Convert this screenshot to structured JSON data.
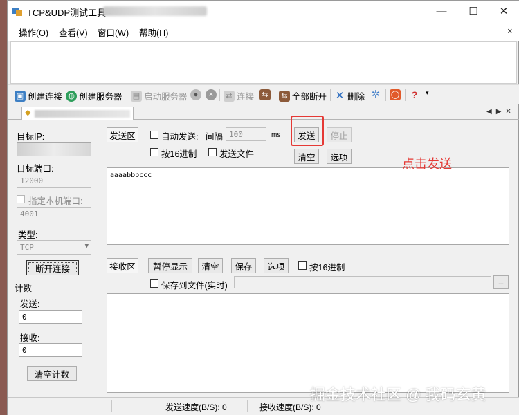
{
  "window": {
    "title": "TCP&UDP测试工具 - ",
    "minimize_glyph": "—",
    "maximize_glyph": "☐",
    "close_glyph": "✕"
  },
  "menu": {
    "items": [
      "操作(O)",
      "查看(V)",
      "窗口(W)",
      "帮助(H)"
    ],
    "close_glyph": "×"
  },
  "toolbar": {
    "create_connection": "创建连接",
    "create_server": "创建服务器",
    "start_server": "启动服务器",
    "connect": "连接",
    "disconnect_all": "全部断开",
    "delete": "删除"
  },
  "left": {
    "target_ip_label": "目标IP:",
    "target_port_label": "目标端口:",
    "target_port_value": "12000",
    "local_port_label": "指定本机端口:",
    "local_port_value": "4001",
    "type_label": "类型:",
    "type_value": "TCP",
    "disconnect_button": "断开连接",
    "count_group_label": "计数",
    "send_label": "发送:",
    "send_count": "0",
    "recv_label": "接收:",
    "recv_count": "0",
    "clear_count_button": "清空计数"
  },
  "send": {
    "zone_label": "发送区",
    "auto_send_label": "自动发送:",
    "interval_label": "间隔",
    "interval_value": "100",
    "interval_unit": "ms",
    "send_button": "发送",
    "stop_button": "停止",
    "hex_label": "按16进制",
    "send_file_label": "发送文件",
    "clear_button": "清空",
    "options_button": "选项",
    "text": "aaaabbbccc"
  },
  "recv": {
    "zone_label": "接收区",
    "pause_button": "暂停显示",
    "clear_button": "清空",
    "save_button": "保存",
    "options_button": "选项",
    "hex_label": "按16进制",
    "save_to_file_label": "保存到文件(实时)",
    "browse_button": "..."
  },
  "status": {
    "send_speed": "发送速度(B/S): 0",
    "recv_speed": "接收速度(B/S): 0"
  },
  "annotation": {
    "text": "点击发送",
    "color": "#e53935"
  },
  "watermark": "掘金技术社区 @ 我码玄黄"
}
